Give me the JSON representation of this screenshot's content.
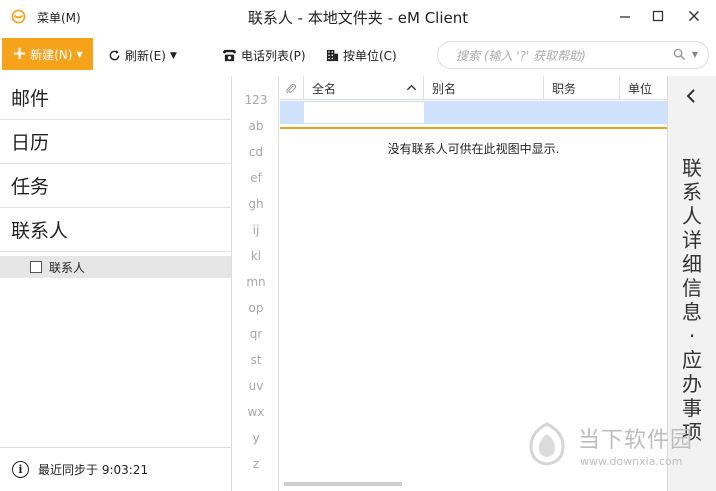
{
  "window": {
    "menu_label": "菜单(M)",
    "title": "联系人 - 本地文件夹 - eM Client",
    "minimize_icon": "minimize-icon",
    "maximize_icon": "maximize-icon",
    "close_icon": "close-icon"
  },
  "toolbar": {
    "new_label": "新建(N)",
    "refresh_label": "刷新(E)",
    "phone_list_label": "电话列表(P)",
    "by_company_label": "按单位(C)",
    "search_placeholder": "搜索 (输入 '?' 获取帮助)",
    "accent_color": "#f7a21b"
  },
  "sidebar": {
    "items": [
      {
        "label": "邮件"
      },
      {
        "label": "日历"
      },
      {
        "label": "任务"
      },
      {
        "label": "联系人"
      }
    ],
    "sub_items": [
      {
        "label": "联系人",
        "checked": false
      }
    ],
    "sync_status": "最近同步于 9:03:21"
  },
  "alpha_index": [
    "123",
    "ab",
    "cd",
    "ef",
    "gh",
    "ij",
    "kl",
    "mn",
    "op",
    "qr",
    "st",
    "uv",
    "wx",
    "y",
    "z"
  ],
  "contact_list": {
    "columns": [
      "全名",
      "别名",
      "职务",
      "单位"
    ],
    "sorted_column": "全名",
    "sort_direction": "ascending",
    "empty_message": "没有联系人可供在此视图中显示."
  },
  "right_panel": {
    "title_part1": "联系人详细信息",
    "separator": "·",
    "title_part2": "应办事项"
  },
  "watermark": {
    "brand": "当下软件园",
    "url": "www.downxia.com"
  }
}
